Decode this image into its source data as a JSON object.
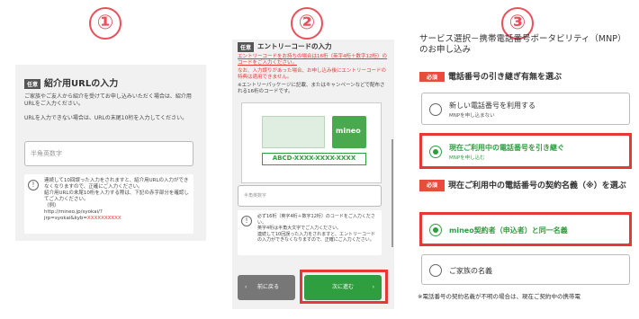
{
  "circle_numbers": [
    "①",
    "②",
    "③"
  ],
  "panel1": {
    "tag": "任意",
    "title": "紹介用URLの入力",
    "desc1": "ご家族やご友人から紹介を受けてお申し込みいただく場合は、紹介用URLをご入力ください。",
    "desc2": "URLを入力できない場合は、URLの末尾10桁を入力してください。",
    "input_placeholder": "半角英数字",
    "notice_lines": [
      "連続して10回誤った入力をされますと、紹介用URLの入力ができなくなりますので、正確にご入力ください。",
      "紹介用URLの末尾10桁を入力する際は、下記の赤字部分を確認してご入力ください。",
      "（例）",
      "http://mineo.jp/syokai/?",
      "jrp=syokai&kyb="
    ],
    "notice_red": "XXXXXXXXXX"
  },
  "panel2": {
    "tag": "任意",
    "title": "エントリーコードの入力",
    "red_line1": "エントリーコードをお持ちの場合は16桁（英字4桁＋数字12桁）のコードをご入力ください。",
    "red_line2": "なお、入力誤りがあった場合、お申し込み後にエントリーコードの特典は適用できません。",
    "desc": "※エントリーパッケージに記載、またはキャンペーンなどで配布される16桁のコードです。",
    "card_logo": "mineo",
    "card_code": "ABCD-XXXX-XXXX-XXXX",
    "input_placeholder": "半角英数字",
    "notice_lines": [
      "必ず16桁（英字4桁＋数字12桁）のコードをご入力ください。",
      "英字4桁は半角大文字でご入力ください。",
      "連続して10回誤った入力をされますと、エントリーコードの入力ができなくなりますので、正確にご入力ください。"
    ],
    "back_label": "前に戻る",
    "next_label": "次に進む"
  },
  "panel3": {
    "heading": "サービス選択－携帯電話番号ポータビリティ（MNP）のお申し込み",
    "q1_tag": "必須",
    "q1_title": "電話番号の引き継ぎ有無を選ぶ",
    "opt1_label": "新しい電話番号を利用する",
    "opt1_sub": "MNPを申し込まない",
    "opt2_label": "現在ご利用中の電話番号を引き継ぐ",
    "opt2_sub": "MNPを申し込む",
    "q2_tag": "必須",
    "q2_title": "現在ご利用中の電話番号の契約名義（※）を選ぶ",
    "opt3_label": "mineo契約者（申込者）と同一名義",
    "opt4_label": "ご家族の名義",
    "footnote": "※電話番号の契約名義が不明の場合は、現在ご契約中の携帯電"
  },
  "colors": {
    "accent_red": "#e53935",
    "green": "#2e9e3f",
    "number_circle": "#e8505b"
  }
}
